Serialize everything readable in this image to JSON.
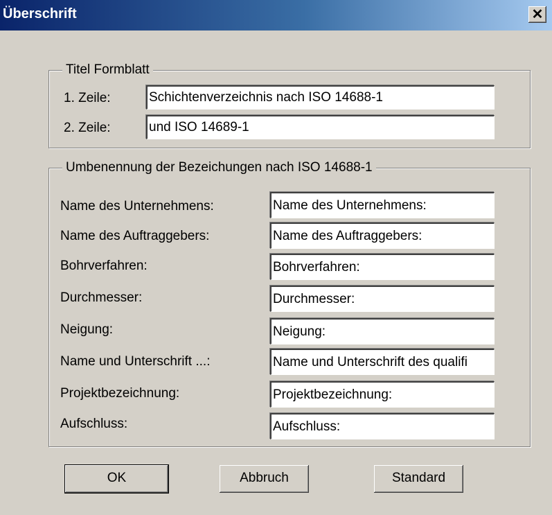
{
  "window": {
    "title": "Überschrift",
    "close_glyph": "✕"
  },
  "titel_group": {
    "legend": "Titel Formblatt",
    "rows": [
      {
        "label": "1. Zeile:",
        "value": "Schichtenverzeichnis nach ISO 14688-1"
      },
      {
        "label": "2. Zeile:",
        "value": "und ISO 14689-1"
      }
    ]
  },
  "umbenennung_group": {
    "legend": "Umbenennung der Bezeichungen nach ISO 14688-1",
    "rows": [
      {
        "label": "Name des Unternehmens:",
        "value": "Name des Unternehmens:"
      },
      {
        "label": "Name des Auftraggebers:",
        "value": "Name des Auftraggebers:"
      },
      {
        "label": "Bohrverfahren:",
        "value": "Bohrverfahren:"
      },
      {
        "label": "Durchmesser:",
        "value": "Durchmesser:"
      },
      {
        "label": "Neigung:",
        "value": "Neigung:"
      },
      {
        "label": "Name und Unterschrift ...:",
        "value": "Name und Unterschrift des qualifi"
      },
      {
        "label": "Projektbezeichnung:",
        "value": "Projektbezeichnung:"
      },
      {
        "label": "Aufschluss:",
        "value": "Aufschluss:"
      }
    ]
  },
  "buttons": {
    "ok": "OK",
    "cancel": "Abbruch",
    "standard": "Standard"
  }
}
